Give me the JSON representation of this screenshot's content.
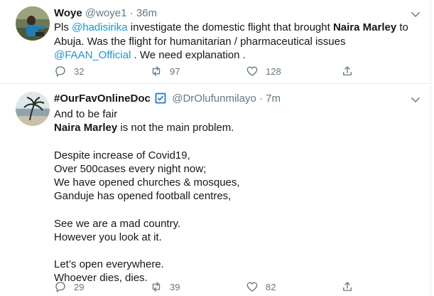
{
  "tweets": [
    {
      "name": "Woye",
      "handle": "@woye1",
      "separator": "·",
      "time": "36m",
      "text_parts": {
        "p1": "Pls ",
        "mention1": "@hadisirika",
        "p2": " investigate the domestic flight that brought ",
        "bold1": "Naira Marley",
        "p3": " to Abuja. Was the flight for humanitarian / pharmaceutical issues ",
        "mention2": "@FAAN_Official",
        "p4": " . We need explanation ."
      },
      "replies": "32",
      "retweets": "97",
      "likes": "128",
      "avatar_icon": "user-photo-icon"
    },
    {
      "name": "#OurFavOnlineDoc",
      "handle": "@DrOlufunmilayo",
      "separator": "·",
      "time": "7m",
      "text_parts": {
        "line1": "And to be fair",
        "bold1": "Naira Marley",
        "line2_rest": " is not the main problem.",
        "rest": "\nDespite increase of Covid19,\nOver 500cases every night now;\nWe have opened churches & mosques,\nGanduje has opened football centres,\n\nSee we are a mad country.\nHowever you look at it.\n\nLet’s open everywhere.\nWhoever dies, dies."
      },
      "replies": "29",
      "retweets": "39",
      "likes": "82",
      "verified_icon": "checkbox-emoji-icon",
      "avatar_icon": "beach-palm-photo-icon"
    }
  ],
  "colors": {
    "link": "#1b95e0",
    "secondary": "#657786",
    "text": "#14171a",
    "border": "#e6ecf0"
  }
}
